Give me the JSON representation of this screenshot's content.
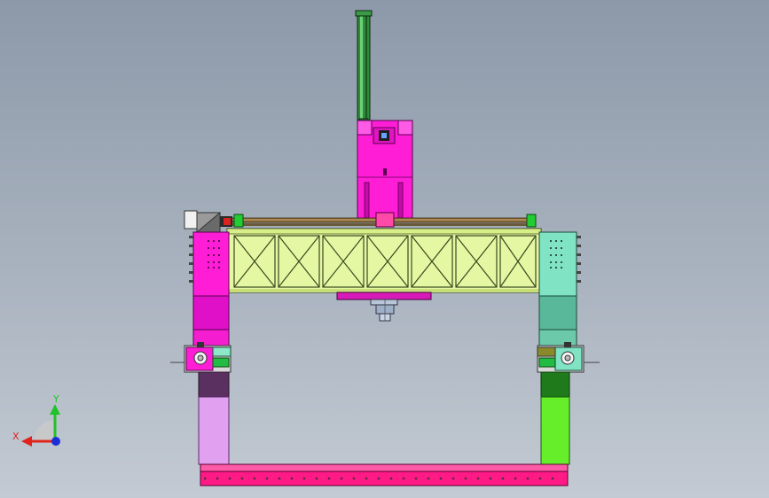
{
  "viewport": {
    "background_top": "#8d99a9",
    "background_bottom": "#c3cad3"
  },
  "model": {
    "parts": {
      "cylinder_rod_color": "#2f8a3a",
      "carriage_color": "#ff1ed6",
      "truss_beam_color": "#e6f7a3",
      "left_column_color": "#ff1ed6",
      "right_column_color": "#7fe3c4",
      "left_lower_leg_color": "#e2a0f0",
      "right_lower_leg_color": "#66ee2a",
      "base_beam_color": "#ff1a86",
      "linear_rail_color": "#8a6a3a"
    }
  },
  "triad": {
    "x_label": "X",
    "y_label": "Y",
    "x_color": "#e0231b",
    "y_color": "#22c22a",
    "z_color": "#1c2fd9",
    "icon": "coordinate-triad-icon"
  }
}
